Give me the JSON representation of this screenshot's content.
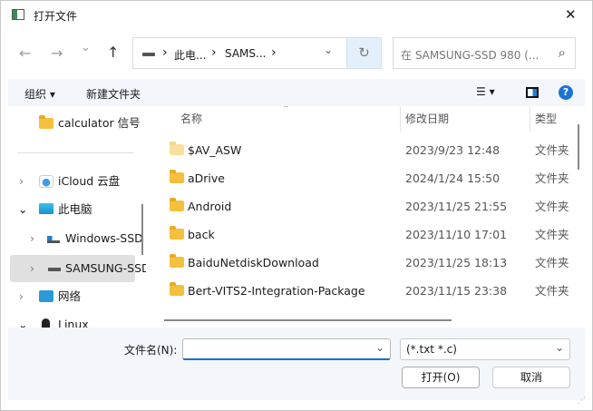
{
  "window": {
    "title": "打开文件",
    "close": "✕"
  },
  "nav": {
    "back": "←",
    "forward": "→",
    "recent": "⌄",
    "up": "↑",
    "breadcrumb": [
      "此电...",
      "SAMS..."
    ],
    "sep": "›",
    "dropdown": "⌄",
    "refresh": "↻",
    "search_placeholder": "在 SAMSUNG-SSD 980 (...",
    "search_icon": "⌕"
  },
  "toolbar": {
    "organize": "组织 ▾",
    "new_folder": "新建文件夹",
    "view": "☰ ▾",
    "help": "?"
  },
  "sidebar": {
    "items": [
      {
        "label": "calculator 信号",
        "icon": "folder"
      },
      {
        "label": "iCloud 云盘",
        "icon": "icloud",
        "chevron": "›"
      },
      {
        "label": "此电脑",
        "icon": "pc",
        "chevron": "⌄"
      },
      {
        "label": "Windows-SSD",
        "icon": "drive",
        "chevron": "›"
      },
      {
        "label": "SAMSUNG-SSD",
        "icon": "drive",
        "chevron": "›"
      },
      {
        "label": "网络",
        "icon": "network",
        "chevron": "›"
      },
      {
        "label": "Linux",
        "icon": "linux",
        "chevron": "⌄"
      }
    ]
  },
  "files": {
    "columns": [
      "名称",
      "修改日期",
      "类型"
    ],
    "rows": [
      {
        "name": "$AV_ASW",
        "date": "2023/9/23 12:48",
        "type": "文件夹",
        "hidden": true
      },
      {
        "name": "aDrive",
        "date": "2024/1/24 15:50",
        "type": "文件夹"
      },
      {
        "name": "Android",
        "date": "2023/11/25 21:55",
        "type": "文件夹"
      },
      {
        "name": "back",
        "date": "2023/11/10 17:01",
        "type": "文件夹"
      },
      {
        "name": "BaiduNetdiskDownload",
        "date": "2023/11/25 18:13",
        "type": "文件夹"
      },
      {
        "name": "Bert-VITS2-Integration-Package",
        "date": "2023/11/15 23:38",
        "type": "文件夹"
      }
    ]
  },
  "bottom": {
    "filename_label": "文件名(N):",
    "filename_value": "",
    "filter": "(*.txt *.c)",
    "open": "打开(O)",
    "cancel": "取消"
  }
}
